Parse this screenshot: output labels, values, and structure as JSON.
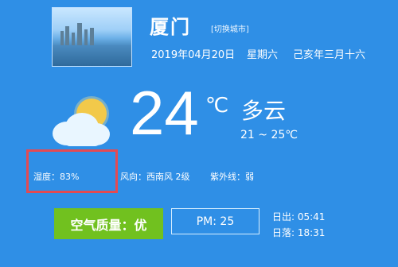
{
  "header": {
    "city": "厦门",
    "switch_city_label": "[切换城市]",
    "date": "2019年04月20日",
    "weekday": "星期六",
    "lunar": "己亥年三月十六"
  },
  "weather": {
    "icon": "partly-cloudy-icon",
    "temperature": "24",
    "temperature_unit": "℃",
    "condition": "多云",
    "range": "21 ~ 25℃"
  },
  "details": {
    "humidity": "湿度：83%",
    "wind": "风向：西南风 2级",
    "uv": "紫外线：弱"
  },
  "air_quality": {
    "label": "空气质量：优",
    "pm": "PM: 25",
    "sunrise": "日出: 05:41",
    "sunset": "日落: 18:31"
  },
  "colors": {
    "background": "#2f8fe6",
    "air_quality_green": "#71c11f",
    "highlight_red": "#e44a52"
  }
}
